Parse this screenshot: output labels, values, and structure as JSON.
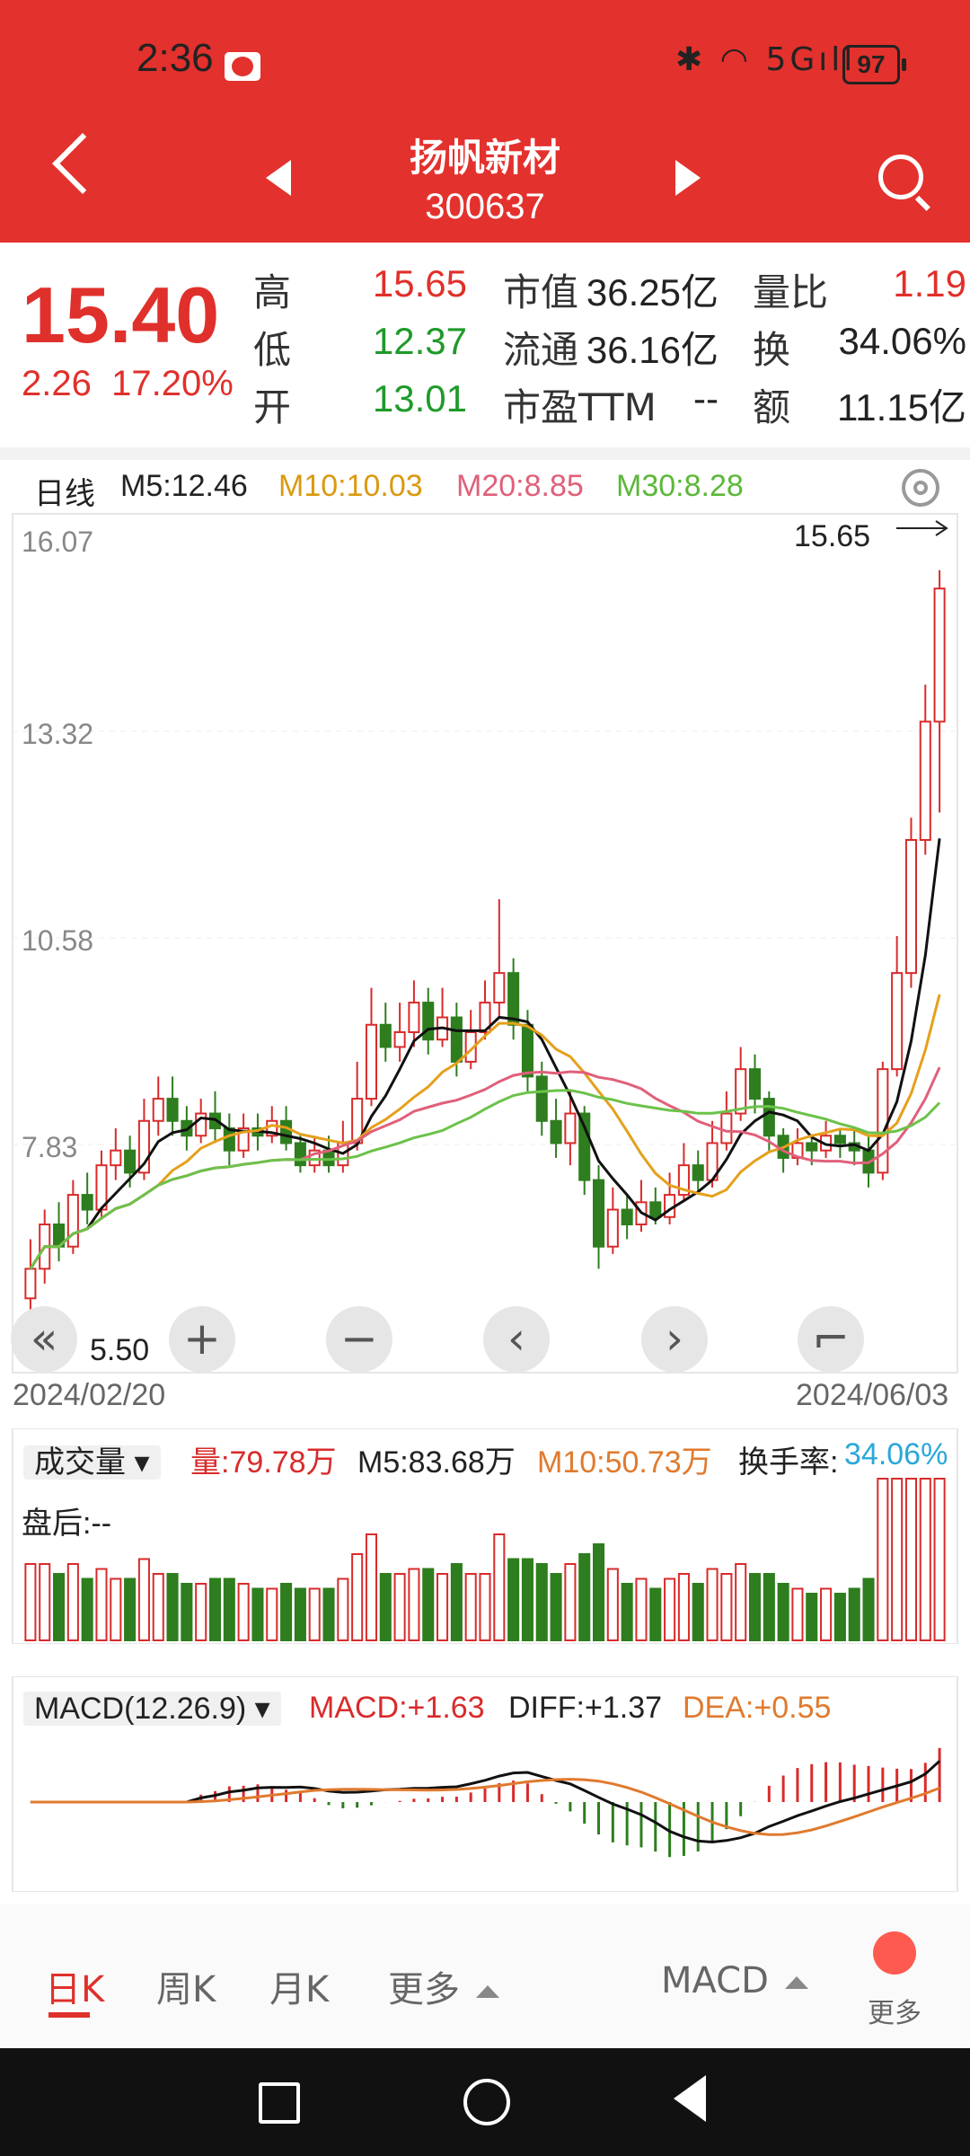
{
  "status": {
    "time": "2:36",
    "net": "5G",
    "battery": "97"
  },
  "header": {
    "name": "扬帆新材",
    "code": "300637"
  },
  "quote": {
    "price": "15.40",
    "change": "2.26",
    "change_pct": "17.20%",
    "rows": [
      [
        {
          "l": "高",
          "v": "15.65",
          "c": "red"
        },
        {
          "l": "市值",
          "v": "36.25亿"
        },
        {
          "l": "量比",
          "v": "1.19",
          "c": "red"
        }
      ],
      [
        {
          "l": "低",
          "v": "12.37",
          "c": "green"
        },
        {
          "l": "流通",
          "v": "36.16亿"
        },
        {
          "l": "换",
          "v": "34.06%"
        }
      ],
      [
        {
          "l": "开",
          "v": "13.01",
          "c": "green"
        },
        {
          "l": "市盈TTM",
          "v": "--"
        },
        {
          "l": "额",
          "v": "11.15亿"
        }
      ]
    ]
  },
  "indicators": {
    "period": "日线",
    "m5": "M5:12.46",
    "m10": "M10:10.03",
    "m20": "M20:8.85",
    "m30": "M30:8.28"
  },
  "colors": {
    "m5": "#111111",
    "m10": "#e5a01b",
    "m20": "#e0607a",
    "m30": "#6cc24a",
    "up": "#d92b2b",
    "down": "#2e7d1e"
  },
  "price_axis": {
    "top": "16.07",
    "l2": "13.32",
    "l3": "10.58",
    "l4": "7.83",
    "bottom": "5.50",
    "high_mark": "15.65"
  },
  "dates": {
    "start": "2024/02/20",
    "end": "2024/06/03"
  },
  "volume": {
    "label": "成交量",
    "amount": "量:79.78万",
    "m5": "M5:83.68万",
    "m10": "M10:50.73万",
    "turnover_label": "换手率:",
    "turnover": "34.06%",
    "after_hours": "盘后:--"
  },
  "macd": {
    "label": "MACD(12.26.9)",
    "macd": "MACD:+1.63",
    "diff": "DIFF:+1.37",
    "dea": "DEA:+0.55"
  },
  "tabs": [
    "日K",
    "周K",
    "月K",
    "更多"
  ],
  "bottom_right": {
    "indicator": "MACD",
    "more": "更多"
  },
  "chart_data": {
    "type": "candlestick",
    "ylim": [
      5.5,
      16.07
    ],
    "yticks": [
      16.07,
      13.32,
      10.58,
      7.83
    ],
    "x_range": [
      "2024/02/20",
      "2024/06/03"
    ],
    "candles": [
      [
        5.8,
        6.2,
        6.6,
        5.6
      ],
      [
        6.2,
        6.8,
        7.0,
        6.0
      ],
      [
        6.8,
        6.5,
        7.1,
        6.3
      ],
      [
        6.5,
        7.2,
        7.4,
        6.4
      ],
      [
        7.2,
        7.0,
        7.5,
        6.8
      ],
      [
        7.0,
        7.6,
        7.8,
        6.9
      ],
      [
        7.6,
        7.8,
        8.1,
        7.4
      ],
      [
        7.8,
        7.5,
        8.0,
        7.3
      ],
      [
        7.5,
        8.2,
        8.5,
        7.4
      ],
      [
        8.2,
        8.5,
        8.8,
        8.0
      ],
      [
        8.5,
        8.2,
        8.8,
        8.0
      ],
      [
        8.2,
        8.0,
        8.4,
        7.8
      ],
      [
        8.0,
        8.3,
        8.5,
        7.9
      ],
      [
        8.3,
        8.1,
        8.6,
        7.9
      ],
      [
        8.1,
        7.8,
        8.3,
        7.6
      ],
      [
        7.8,
        8.1,
        8.3,
        7.7
      ],
      [
        8.1,
        8.0,
        8.3,
        7.8
      ],
      [
        8.0,
        8.2,
        8.4,
        7.9
      ],
      [
        8.2,
        7.9,
        8.4,
        7.8
      ],
      [
        7.9,
        7.6,
        8.0,
        7.5
      ],
      [
        7.6,
        7.8,
        8.0,
        7.5
      ],
      [
        7.8,
        7.6,
        8.0,
        7.5
      ],
      [
        7.6,
        7.9,
        8.2,
        7.5
      ],
      [
        7.9,
        8.5,
        9.0,
        7.8
      ],
      [
        8.5,
        9.5,
        10.0,
        8.4
      ],
      [
        9.5,
        9.2,
        9.8,
        9.0
      ],
      [
        9.2,
        9.4,
        9.8,
        9.0
      ],
      [
        9.4,
        9.8,
        10.1,
        9.2
      ],
      [
        9.8,
        9.3,
        10.0,
        9.1
      ],
      [
        9.3,
        9.6,
        10.0,
        9.2
      ],
      [
        9.6,
        9.0,
        9.8,
        8.8
      ],
      [
        9.0,
        9.4,
        9.7,
        8.9
      ],
      [
        9.4,
        9.8,
        10.1,
        9.3
      ],
      [
        9.8,
        10.2,
        11.2,
        9.6
      ],
      [
        10.2,
        9.5,
        10.4,
        9.3
      ],
      [
        9.5,
        8.8,
        9.7,
        8.6
      ],
      [
        8.8,
        8.2,
        9.0,
        8.0
      ],
      [
        8.2,
        7.9,
        8.5,
        7.7
      ],
      [
        7.9,
        8.3,
        8.6,
        7.6
      ],
      [
        8.3,
        7.4,
        8.4,
        7.2
      ],
      [
        7.4,
        6.5,
        7.6,
        6.2
      ],
      [
        6.5,
        7.0,
        7.3,
        6.4
      ],
      [
        7.0,
        6.8,
        7.2,
        6.6
      ],
      [
        6.8,
        7.1,
        7.4,
        6.7
      ],
      [
        7.1,
        6.9,
        7.3,
        6.8
      ],
      [
        6.9,
        7.2,
        7.5,
        6.8
      ],
      [
        7.2,
        7.6,
        7.9,
        7.1
      ],
      [
        7.6,
        7.4,
        7.8,
        7.2
      ],
      [
        7.4,
        7.9,
        8.2,
        7.3
      ],
      [
        7.9,
        8.3,
        8.6,
        7.8
      ],
      [
        8.3,
        8.9,
        9.2,
        8.2
      ],
      [
        8.9,
        8.5,
        9.1,
        8.3
      ],
      [
        8.5,
        8.0,
        8.6,
        7.8
      ],
      [
        8.0,
        7.7,
        8.1,
        7.5
      ],
      [
        7.7,
        7.9,
        8.1,
        7.6
      ],
      [
        7.9,
        7.8,
        8.0,
        7.6
      ],
      [
        7.8,
        8.0,
        8.2,
        7.7
      ],
      [
        8.0,
        7.9,
        8.1,
        7.7
      ],
      [
        7.9,
        7.8,
        8.1,
        7.6
      ],
      [
        7.8,
        7.5,
        8.0,
        7.3
      ],
      [
        7.5,
        8.9,
        9.0,
        7.4
      ],
      [
        8.9,
        10.2,
        10.7,
        8.8
      ],
      [
        10.2,
        12.0,
        12.3,
        10.0
      ],
      [
        12.0,
        13.6,
        14.1,
        11.8
      ],
      [
        13.6,
        15.4,
        15.65,
        12.37
      ]
    ]
  }
}
